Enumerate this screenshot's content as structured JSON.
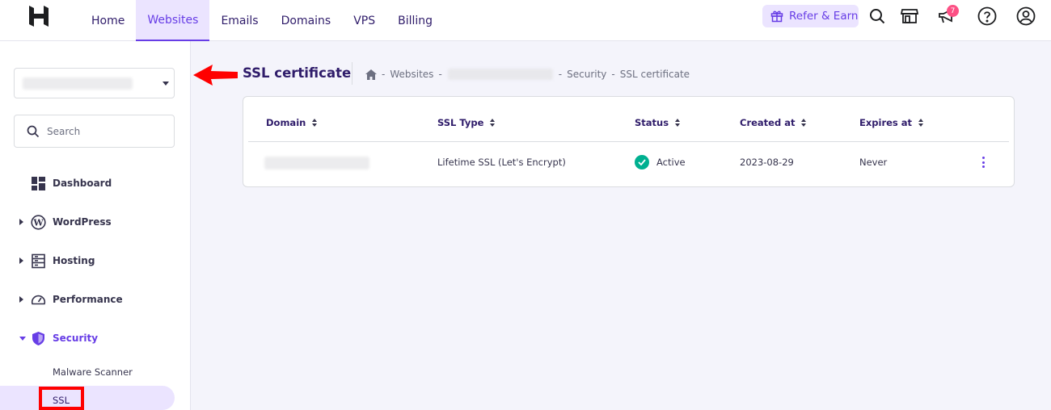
{
  "nav": {
    "items": [
      {
        "label": "Home"
      },
      {
        "label": "Websites"
      },
      {
        "label": "Emails"
      },
      {
        "label": "Domains"
      },
      {
        "label": "VPS"
      },
      {
        "label": "Billing"
      }
    ],
    "active": "Websites",
    "refer_label": "Refer & Earn",
    "notification_count": "7"
  },
  "sidebar": {
    "search_placeholder": "Search",
    "menu": [
      {
        "label": "Dashboard",
        "icon": "dashboard-icon"
      },
      {
        "label": "WordPress",
        "icon": "wordpress-icon"
      },
      {
        "label": "Hosting",
        "icon": "hosting-icon"
      },
      {
        "label": "Performance",
        "icon": "gauge-icon"
      },
      {
        "label": "Security",
        "icon": "shield-icon"
      }
    ],
    "security_sub": [
      "Malware Scanner",
      "SSL"
    ]
  },
  "page": {
    "title": "SSL certificate",
    "breadcrumb": {
      "sep": "-",
      "websites": "Websites",
      "security": "Security",
      "current": "SSL certificate"
    }
  },
  "table": {
    "headers": [
      "Domain",
      "SSL Type",
      "Status",
      "Created at",
      "Expires at"
    ],
    "rows": [
      {
        "ssl_type": "Lifetime SSL (Let's Encrypt)",
        "status": "Active",
        "created": "2023-08-29",
        "expires": "Never"
      }
    ]
  },
  "colors": {
    "accent": "#673de6",
    "accent_light": "#ebe4ff",
    "success": "#00b090",
    "annotation": "#ff0000",
    "badge": "#fc5185"
  }
}
